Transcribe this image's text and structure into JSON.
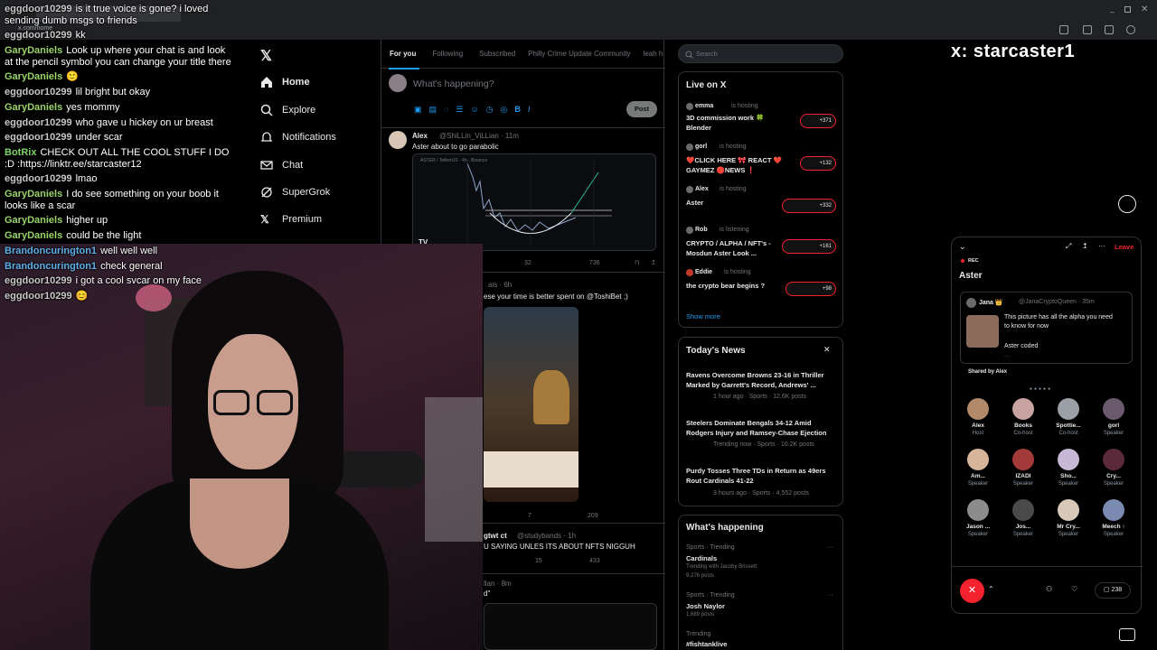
{
  "browser": {
    "url": "x.com/home"
  },
  "chat": [
    {
      "user": "eggdoor10299",
      "msg": "is it true voice is gone? i loved sending dumb msgs to friends",
      "cls": "u-egg"
    },
    {
      "user": "eggdoor10299",
      "msg": "kk",
      "cls": "u-egg"
    },
    {
      "user": "GaryDaniels",
      "msg": "Look up where your chat is and look at the pencil symbol you can change your title there",
      "cls": "u-gary"
    },
    {
      "user": "GaryDaniels",
      "msg": "🙂",
      "cls": "u-gary"
    },
    {
      "user": "eggdoor10299",
      "msg": "lil bright but okay",
      "cls": "u-egg"
    },
    {
      "user": "GaryDaniels",
      "msg": "yes mommy",
      "cls": "u-gary"
    },
    {
      "user": "eggdoor10299",
      "msg": "who gave u hickey on ur breast",
      "cls": "u-egg"
    },
    {
      "user": "eggdoor10299",
      "msg": "under scar",
      "cls": "u-egg"
    },
    {
      "user": "BotRix",
      "msg": "CHECK OUT ALL THE COOL STUFF I DO :D :https://linktr.ee/starcaster12",
      "cls": "u-bot"
    },
    {
      "user": "eggdoor10299",
      "msg": "lmao",
      "cls": "u-egg"
    },
    {
      "user": "GaryDaniels",
      "msg": "I do see something on your boob it looks like a scar",
      "cls": "u-gary"
    },
    {
      "user": "GaryDaniels",
      "msg": "higher up",
      "cls": "u-gary"
    },
    {
      "user": "GaryDaniels",
      "msg": "could be the light",
      "cls": "u-gary"
    },
    {
      "user": "Brandoncurington1",
      "msg": "well well well",
      "cls": "u-brand"
    },
    {
      "user": "Brandoncurington1",
      "msg": "check general",
      "cls": "u-brand"
    },
    {
      "user": "eggdoor10299",
      "msg": "i got a cool svcar on my face",
      "cls": "u-egg"
    },
    {
      "user": "eggdoor10299",
      "msg": "😊",
      "cls": "u-egg"
    }
  ],
  "nav": {
    "home": "Home",
    "explore": "Explore",
    "notifications": "Notifications",
    "chat": "Chat",
    "supergrok": "SuperGrok",
    "premium": "Premium"
  },
  "feed": {
    "tabs": [
      "For you",
      "Following",
      "Subscribed",
      "Philly Crime Update Community",
      "leah h"
    ],
    "compose_placeholder": "What's happening?",
    "post_label": "Post",
    "tweet1": {
      "name": "Alex",
      "handle": "@ShiLLin_ViLLian · 11m",
      "text": "Aster about to go parabolic",
      "chart_label": "ASTER / TetherUS · 4h · Binance",
      "replies": "32",
      "views": "736"
    },
    "tweet2": {
      "handle": "ais · 6h",
      "text": "ese your time is better spent on @ToshiBet ;)",
      "likes": "7",
      "views": "209"
    },
    "tweet3": {
      "name": "gtwt ct",
      "handle": "@studybands · 1h",
      "text": "U SAYING UNLES ITS ABOUT NFTS NIGGUH",
      "likes": "15",
      "views": "433"
    },
    "tweet4": {
      "handle": "llan · 8m",
      "text": "d\""
    }
  },
  "search": {
    "placeholder": "Search"
  },
  "live": {
    "title": "Live on X",
    "items": [
      {
        "host": "emma",
        "status": "is hosting",
        "title": "3D commission work 🍀",
        "title2": "Blender",
        "count": "+371"
      },
      {
        "host": "gorl",
        "status": "is hosting",
        "title": "❤️CLICK HERE 🎀 REACT ❤️",
        "title2": "GAYMEZ 🔴NEWS ❗",
        "count": "+132"
      },
      {
        "host": "Alex",
        "status": "is hosting",
        "title": "Aster",
        "title2": "",
        "count": "+332"
      },
      {
        "host": "Rob",
        "status": "is listening",
        "title": "CRYPTO / ALPHA / NFT's -",
        "title2": "Mosdun Aster Look ...",
        "count": "+161"
      },
      {
        "host": "Eddie",
        "status": "is hosting",
        "title": "the crypto bear begins ?",
        "title2": "",
        "count": "+98"
      }
    ],
    "show_more": "Show more"
  },
  "news": {
    "title": "Today's News",
    "items": [
      {
        "headline": "Ravens Overcome Browns 23-16 in Thriller",
        "headline2": "Marked by Garrett's Record, Andrews' ...",
        "meta": "1 hour ago · Sports · 12.6K posts"
      },
      {
        "headline": "Steelers Dominate Bengals 34-12 Amid",
        "headline2": "Rodgers Injury and Ramsey-Chase Ejection",
        "meta": "Trending now · Sports · 10.2K posts"
      },
      {
        "headline": "Purdy Tosses Three TDs in Return as 49ers",
        "headline2": "Rout Cardinals 41-22",
        "meta": "3 hours ago · Sports · 4,552 posts"
      }
    ]
  },
  "happening": {
    "title": "What's happening",
    "items": [
      {
        "cat": "Sports · Trending",
        "name": "Cardinals",
        "extra": "Trending with Jacoby Brissett",
        "posts": "9,276 posts"
      },
      {
        "cat": "Sports · Trending",
        "name": "Josh Naylor",
        "extra": "",
        "posts": "1,689 posts"
      },
      {
        "cat": "Trending",
        "name": "#fishtanklive",
        "extra": "",
        "posts": ""
      }
    ]
  },
  "overlay_brand": "x: starcaster1",
  "space": {
    "rec": "REC",
    "leave": "Leave",
    "title": "Aster",
    "card_author": "Jana 👑",
    "card_handle": "@JanaCryptoQueen · 35m",
    "card_text": "This picture has all the alpha you need",
    "card_text2": "to know for now",
    "card_sub": "Aster coded",
    "card_more": "...",
    "shared_by": "Shared by Alex",
    "speakers": [
      {
        "name": "Alex",
        "role": "Host"
      },
      {
        "name": "Books",
        "role": "Co-host"
      },
      {
        "name": "Spottie...",
        "role": "Co-host"
      },
      {
        "name": "gorl",
        "role": "Speaker"
      },
      {
        "name": "Am...",
        "role": "Speaker"
      },
      {
        "name": "IZADI",
        "role": "Speaker"
      },
      {
        "name": "Sho...",
        "role": "Speaker"
      },
      {
        "name": "Cry...",
        "role": "Speaker"
      },
      {
        "name": "Jason ...",
        "role": "Speaker"
      },
      {
        "name": "Jos...",
        "role": "Speaker"
      },
      {
        "name": "Mr Cry...",
        "role": "Speaker"
      },
      {
        "name": "Meech ↑",
        "role": "Speaker"
      }
    ],
    "reply_count": "238"
  },
  "colors": {
    "accent": "#1d9bf0",
    "live_red": "#f4212e",
    "bg": "#000000"
  }
}
